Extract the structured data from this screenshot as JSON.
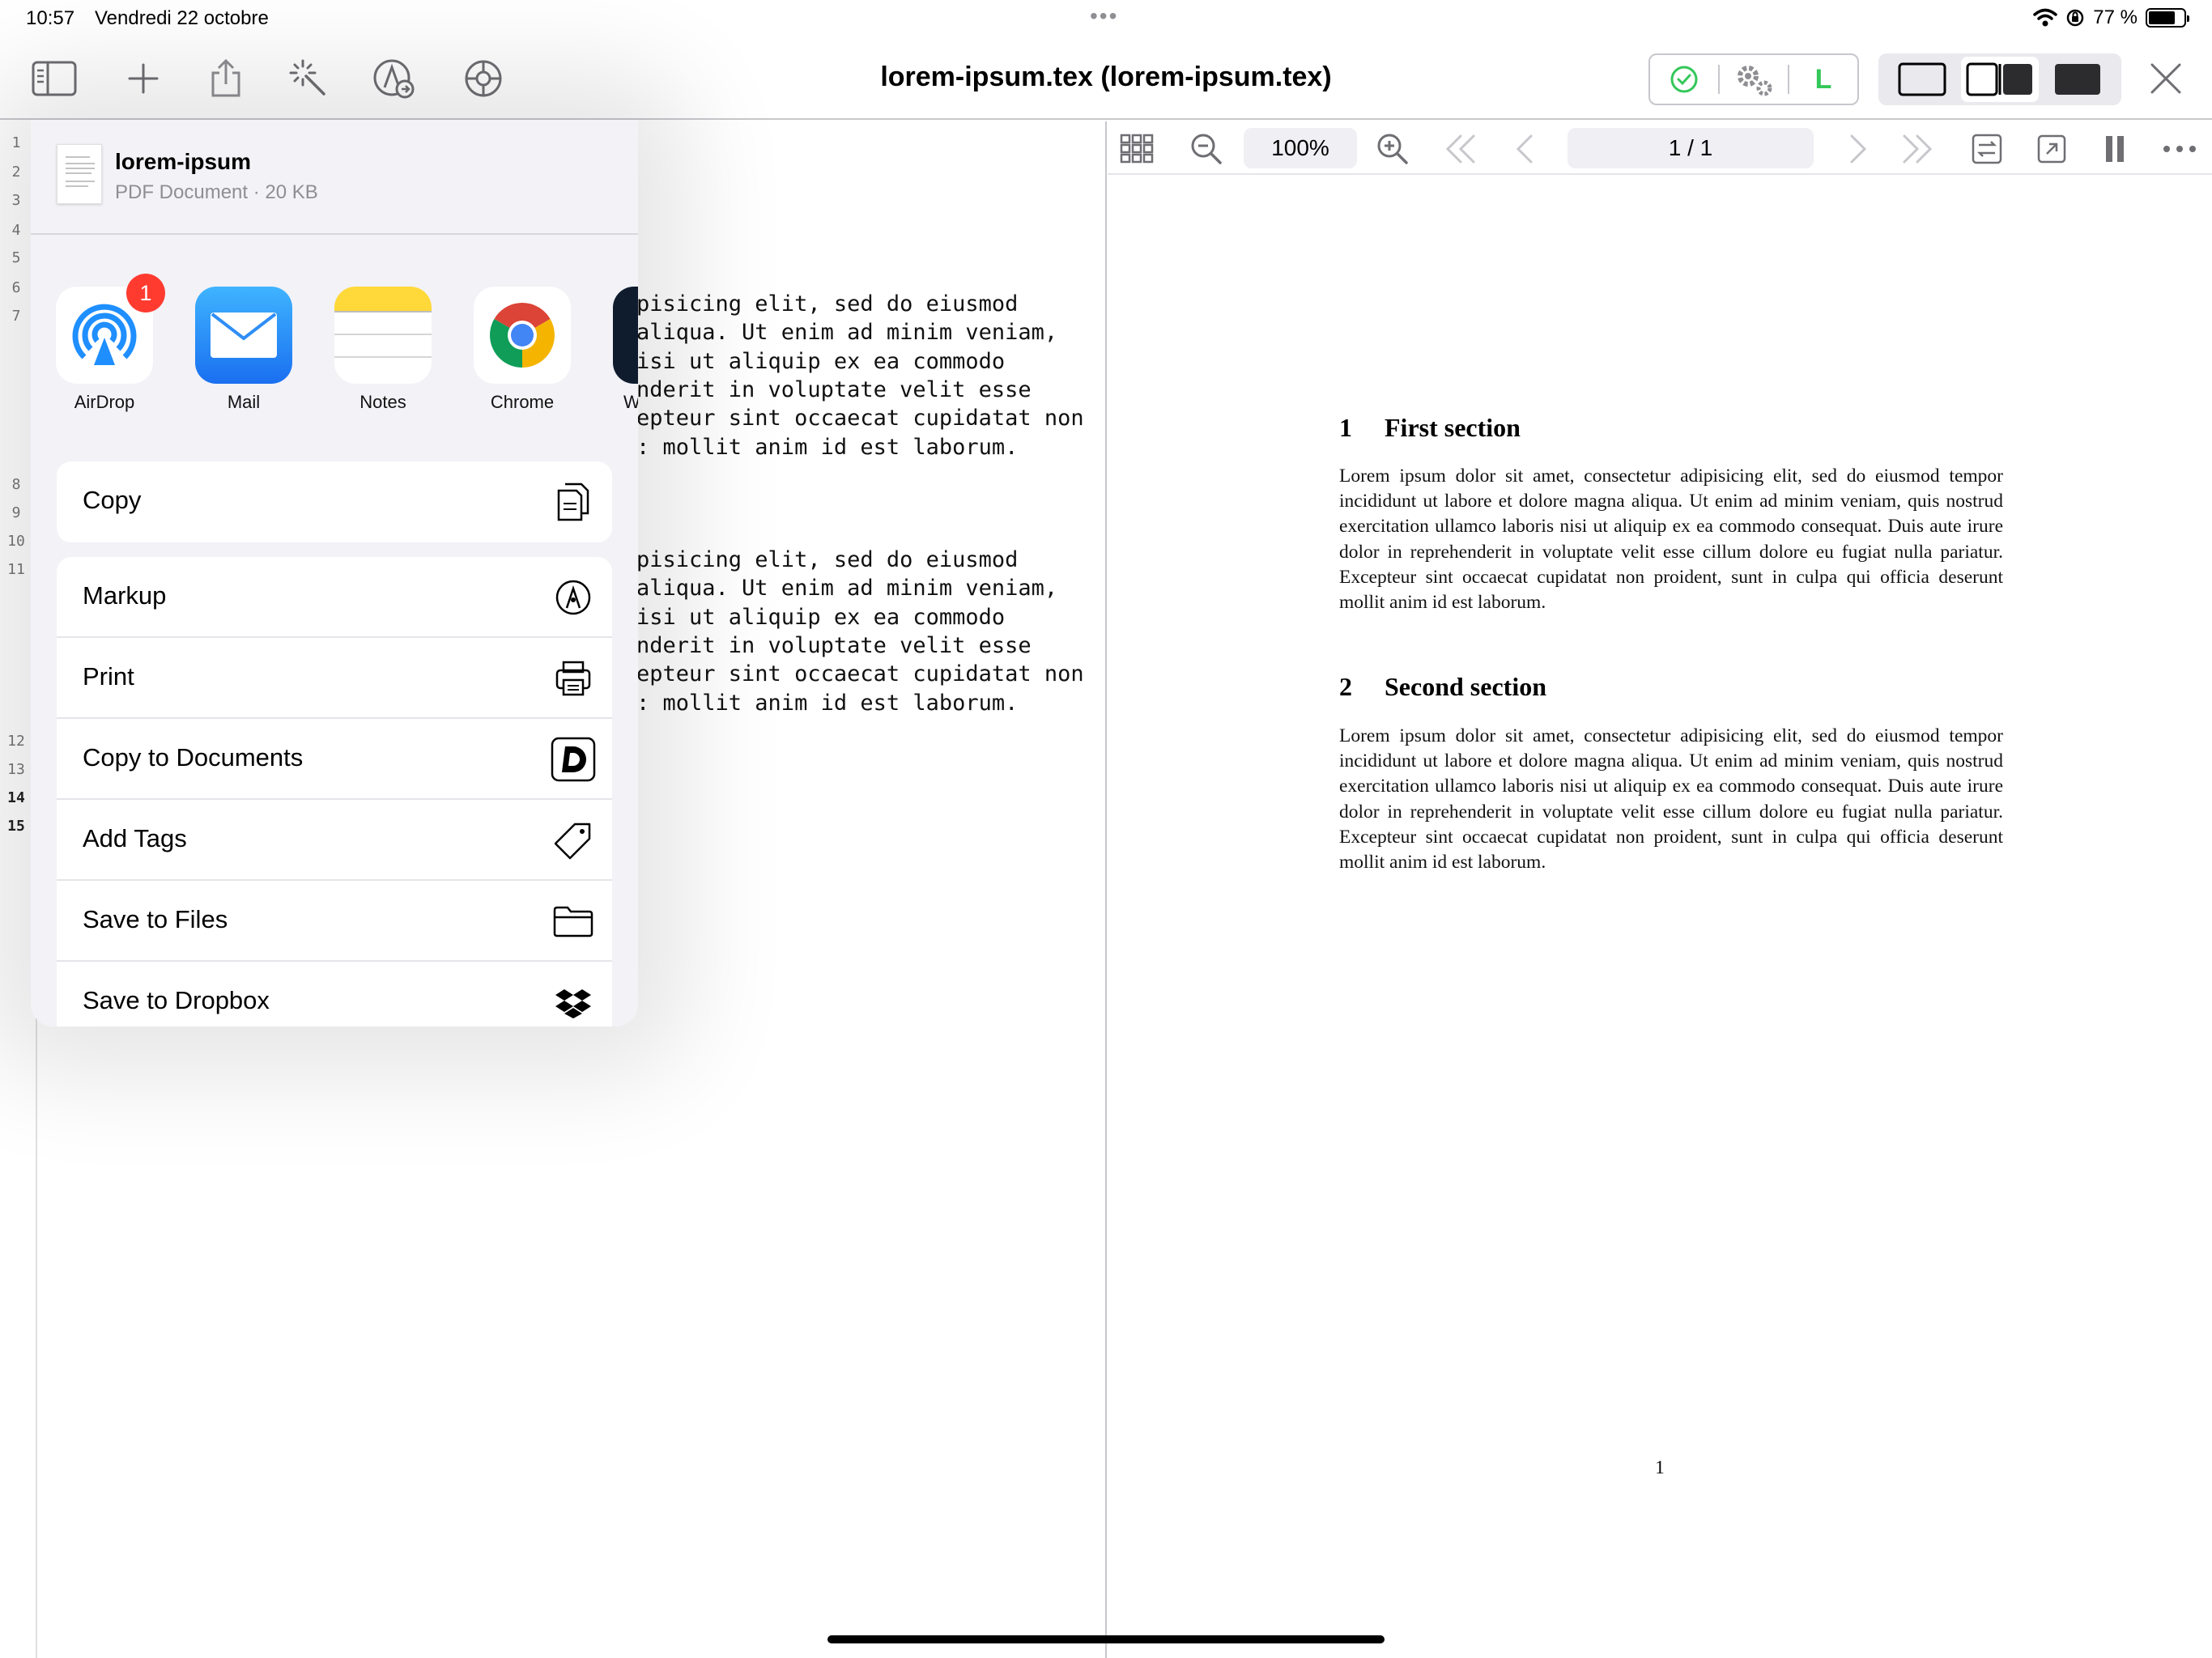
{
  "status_bar": {
    "time": "10:57",
    "date": "Vendredi 22 octobre",
    "battery": "77 %",
    "battery_level": 0.77
  },
  "toolbar": {
    "title": "lorem-ipsum.tex (lorem-ipsum.tex)",
    "status_letter": "L",
    "status_color": "#34c759",
    "icons": [
      "sidebar-icon",
      "plus-icon",
      "share-icon",
      "magic-wand-icon",
      "markup-icon",
      "settings-icon",
      "checkmark-icon",
      "gears-icon",
      "close-icon"
    ]
  },
  "editor": {
    "line_numbers": [
      {
        "n": "1"
      },
      {
        "n": "2"
      },
      {
        "n": "3"
      },
      {
        "n": "4"
      },
      {
        "n": "5"
      },
      {
        "n": "6"
      },
      {
        "n": "7"
      },
      {
        "n": "8"
      },
      {
        "n": "9"
      },
      {
        "n": "10"
      },
      {
        "n": "11"
      },
      {
        "n": "12"
      },
      {
        "n": "13"
      },
      {
        "n": "14"
      },
      {
        "n": "15"
      }
    ],
    "code_lines_block1": [
      "pisicing elit, sed do eiusmod",
      "aliqua. Ut enim ad minim veniam,",
      "isi ut aliquip ex ea commodo",
      "nderit in voluptate velit esse",
      "epteur sint occaecat cupidatat non",
      ": mollit anim id est laborum."
    ],
    "code_lines_block2": [
      "pisicing elit, sed do eiusmod",
      "aliqua. Ut enim ad minim veniam,",
      "isi ut aliquip ex ea commodo",
      "nderit in voluptate velit esse",
      "epteur sint occaecat cupidatat non",
      ": mollit anim id est laborum."
    ]
  },
  "pdf_toolbar": {
    "zoom": "100%",
    "page": "1 / 1"
  },
  "pdf": {
    "sections": [
      {
        "number": "1",
        "title": "First section",
        "text": "Lorem ipsum dolor sit amet, consectetur adipisicing elit, sed do eiusmod tempor incididunt ut labore et dolore magna aliqua. Ut enim ad minim veniam, quis nostrud exercitation ullamco laboris nisi ut aliquip ex ea commodo consequat. Duis aute irure dolor in reprehenderit in voluptate velit esse cillum dolore eu fugiat nulla pariatur. Excepteur sint occaecat cupidatat non proident, sunt in culpa qui officia deserunt mollit anim id est laborum."
      },
      {
        "number": "2",
        "title": "Second section",
        "text": "Lorem ipsum dolor sit amet, consectetur adipisicing elit, sed do eiusmod tempor incididunt ut labore et dolore magna aliqua. Ut enim ad minim veniam, quis nostrud exercitation ullamco laboris nisi ut aliquip ex ea commodo consequat. Duis aute irure dolor in reprehenderit in voluptate velit esse cillum dolore eu fugiat nulla pariatur. Excepteur sint occaecat cupidatat non proident, sunt in culpa qui officia deserunt mollit anim id est laborum."
      }
    ],
    "page_number": "1"
  },
  "share_sheet": {
    "doc_name": "lorem-ipsum",
    "doc_meta": "PDF Document · 20 KB",
    "airdrop_badge": "1",
    "apps": [
      {
        "label": "AirDrop",
        "icon": "airdrop-icon"
      },
      {
        "label": "Mail",
        "icon": "mail-icon"
      },
      {
        "label": "Notes",
        "icon": "notes-icon"
      },
      {
        "label": "Chrome",
        "icon": "chrome-icon"
      },
      {
        "label": "Worl",
        "icon": "app-icon"
      }
    ],
    "actions_group1": [
      {
        "label": "Copy",
        "icon": "copy-icon"
      }
    ],
    "actions_group2": [
      {
        "label": "Markup",
        "icon": "markup-icon"
      },
      {
        "label": "Print",
        "icon": "print-icon"
      },
      {
        "label": "Copy to Documents",
        "icon": "documents-icon"
      },
      {
        "label": "Add Tags",
        "icon": "tag-icon"
      },
      {
        "label": "Save to Files",
        "icon": "folder-icon"
      },
      {
        "label": "Save to Dropbox",
        "icon": "dropbox-icon"
      }
    ]
  }
}
